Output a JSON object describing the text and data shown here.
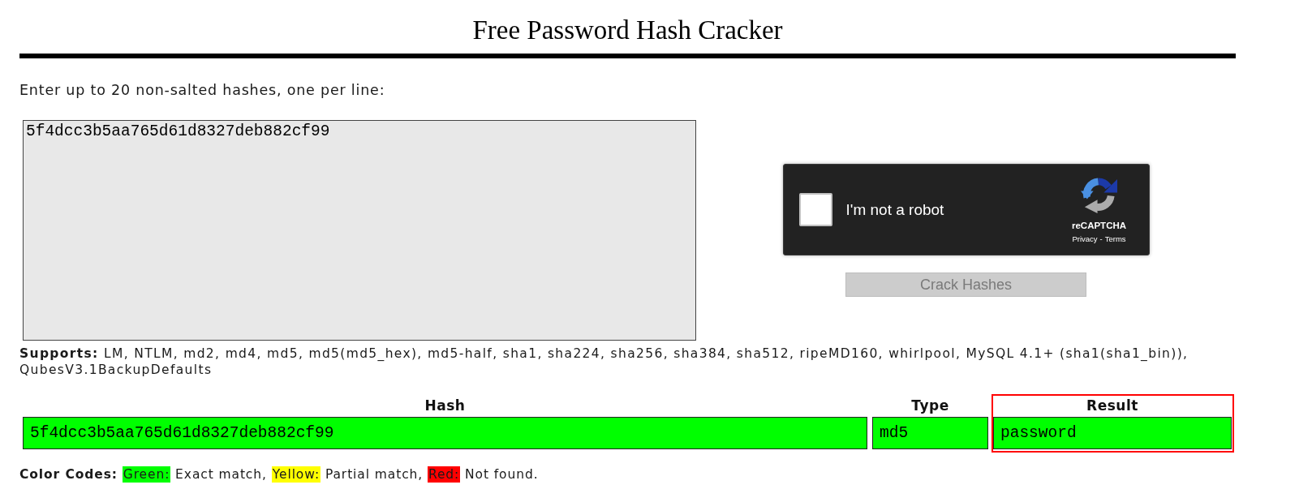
{
  "title": "Free Password Hash Cracker",
  "intro": "Enter up to 20 non-salted hashes, one per line:",
  "hash_input": {
    "value": "5f4dcc3b5aa765d61d8327deb882cf99"
  },
  "captcha": {
    "label": "I'm not a robot",
    "checked": false,
    "brand": "reCAPTCHA",
    "links": [
      "Privacy",
      "Terms"
    ],
    "separator": "-"
  },
  "crack_button": {
    "label": "Crack Hashes",
    "disabled": true
  },
  "supports": "**Supports:** LM, NTLM, md2, md4, md5, md5(md5_hex), md5-half, sha1, sha224, sha256, sha384, sha512, ripeMD160, whirlpool, MySQL 4.1+ (sha1(sha1_bin)), QubesV3.1BackupDefaults",
  "table": {
    "columns": [
      {
        "label": "Hash",
        "highlighted": false
      },
      {
        "label": "Type",
        "highlighted": false
      },
      {
        "label": "Result",
        "highlighted": true
      }
    ],
    "rows": [
      {
        "color": "#00ff00",
        "cells": [
          "5f4dcc3b5aa765d61d8327deb882cf99",
          "md5",
          "password"
        ]
      }
    ]
  },
  "color_codes": {
    "label": "Color Codes:",
    "items": [
      {
        "key": "Green:",
        "description": "Exact match,",
        "color": "#00ff00"
      },
      {
        "key": "Yellow:",
        "description": "Partial match,",
        "color": "#ffff00"
      },
      {
        "key": "Red:",
        "description": "Not found.",
        "color": "#ff0000"
      }
    ]
  }
}
